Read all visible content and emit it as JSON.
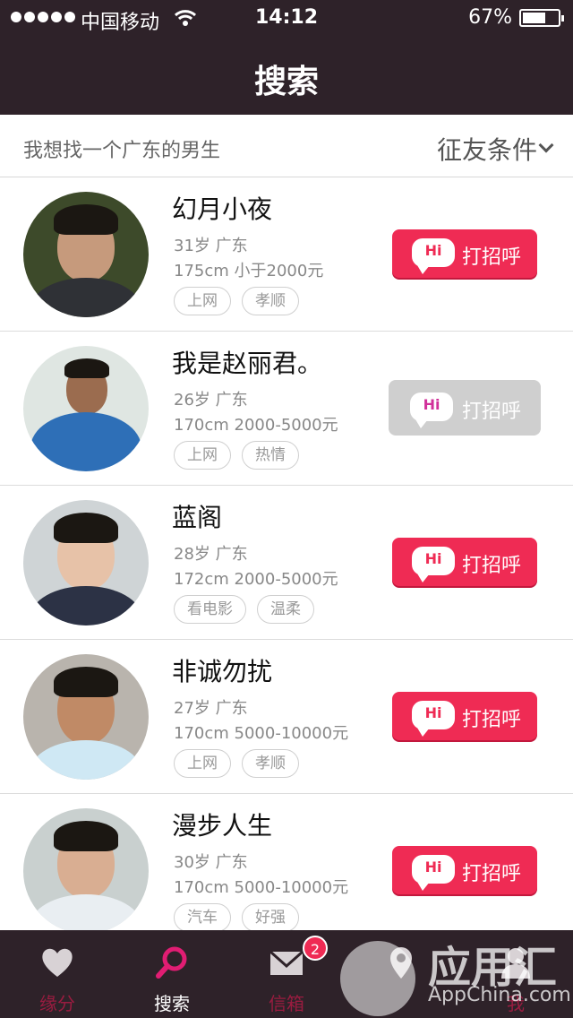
{
  "status_bar": {
    "carrier": "中国移动",
    "time": "14:12",
    "battery_text": "67%",
    "battery_level": 0.67
  },
  "nav": {
    "title": "搜索"
  },
  "filter": {
    "query": "我想找一个广东的男生",
    "criteria_label": "征友条件"
  },
  "users": [
    {
      "name": "幻月小夜",
      "age_location": "31岁 广东",
      "height_income": "175cm 小于2000元",
      "tags": [
        "上网",
        "孝顺"
      ],
      "greet_label": "打招呼",
      "greet_enabled": true
    },
    {
      "name": "我是赵丽君。",
      "age_location": "26岁 广东",
      "height_income": "170cm 2000-5000元",
      "tags": [
        "上网",
        "热情"
      ],
      "greet_label": "打招呼",
      "greet_enabled": false
    },
    {
      "name": "蓝阁",
      "age_location": "28岁 广东",
      "height_income": "172cm 2000-5000元",
      "tags": [
        "看电影",
        "温柔"
      ],
      "greet_label": "打招呼",
      "greet_enabled": true
    },
    {
      "name": "非诚勿扰",
      "age_location": "27岁 广东",
      "height_income": "170cm 5000-10000元",
      "tags": [
        "上网",
        "孝顺"
      ],
      "greet_label": "打招呼",
      "greet_enabled": true
    },
    {
      "name": "漫步人生",
      "age_location": "30岁 广东",
      "height_income": "170cm 5000-10000元",
      "tags": [
        "汽车",
        "好强"
      ],
      "greet_label": "打招呼",
      "greet_enabled": true
    }
  ],
  "greet_icon_text": "Hi",
  "tabs": [
    {
      "label": "缘分",
      "icon": "heart-icon",
      "active": false
    },
    {
      "label": "搜索",
      "icon": "search-icon",
      "active": true
    },
    {
      "label": "信箱",
      "icon": "mail-icon",
      "active": false
    },
    {
      "label": "",
      "icon": "location-icon",
      "active": false
    },
    {
      "label": "我",
      "icon": "user-icon",
      "active": false
    }
  ],
  "mail_badge": "2",
  "watermark": {
    "brand": "应用汇",
    "brand_sub": "AppChina.com"
  },
  "colors": {
    "header_bg": "#2e2229",
    "accent": "#ef2b54",
    "active_tab": "#ffffff",
    "inactive_tab": "#9a1c40"
  }
}
